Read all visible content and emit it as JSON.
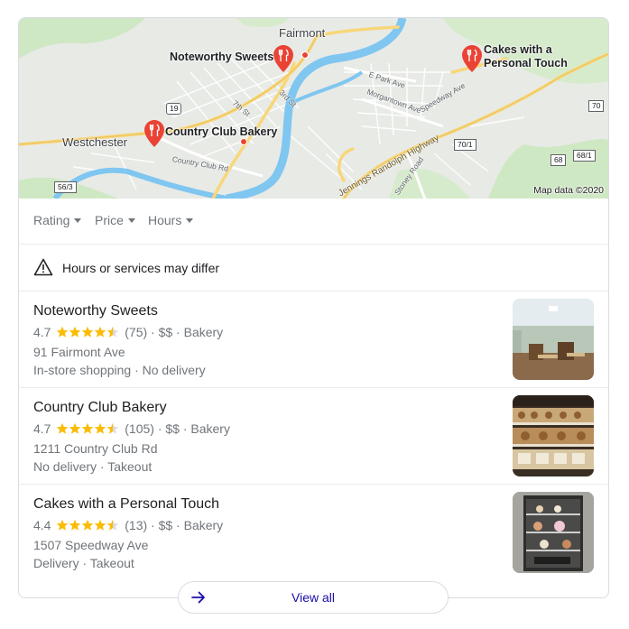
{
  "map": {
    "places": {
      "fairmont": "Fairmont",
      "westchester": "Westchester"
    },
    "pins": [
      {
        "name": "Noteworthy Sweets"
      },
      {
        "name": "Country Club Bakery"
      },
      {
        "name": "Cakes with a Personal Touch"
      }
    ],
    "streets": {
      "e_park": "E Park Ave",
      "morgantown": "Morgantown Ave",
      "speedway": "Speedway Ave",
      "seventh": "7th St",
      "third": "3rd St",
      "country_club": "Country Club Rd",
      "jennings": "Jennings Randolph Highway",
      "stoney": "Stoney Road"
    },
    "shields": {
      "r19": "19",
      "r70": "70",
      "r701": "70/1",
      "r68": "68",
      "r681": "68/1",
      "r563": "56/3"
    },
    "attribution": "Map data ©2020",
    "colors": {
      "water": "#7fc6f0",
      "highway": "#f8d77a",
      "land": "#e8eae6",
      "green": "#cfe8c4",
      "pin": "#ea4335"
    }
  },
  "filters": [
    {
      "label": "Rating"
    },
    {
      "label": "Price"
    },
    {
      "label": "Hours"
    }
  ],
  "notice": {
    "icon": "warning-icon",
    "text": "Hours or services may differ"
  },
  "results": [
    {
      "name": "Noteworthy Sweets",
      "rating": "4.7",
      "reviews": "(75)",
      "price_category": "· $$ · Bakery",
      "address": "91 Fairmont Ave",
      "services": "In-store shopping · No delivery",
      "stars": 4.5
    },
    {
      "name": "Country Club Bakery",
      "rating": "4.7",
      "reviews": "(105)",
      "price_category": "· $$ · Bakery",
      "address": "1211 Country Club Rd",
      "services": "No delivery · Takeout",
      "stars": 4.5
    },
    {
      "name": "Cakes with a Personal Touch",
      "rating": "4.4",
      "reviews": "(13)",
      "price_category": "· $$ · Bakery",
      "address": "1507 Speedway Ave",
      "services": "Delivery · Takeout",
      "stars": 4.5
    }
  ],
  "view_all": {
    "label": "View all",
    "icon": "arrow-right-icon"
  },
  "colors": {
    "star": "#fbbc04",
    "link": "#1a0dab",
    "muted": "#70757a"
  }
}
